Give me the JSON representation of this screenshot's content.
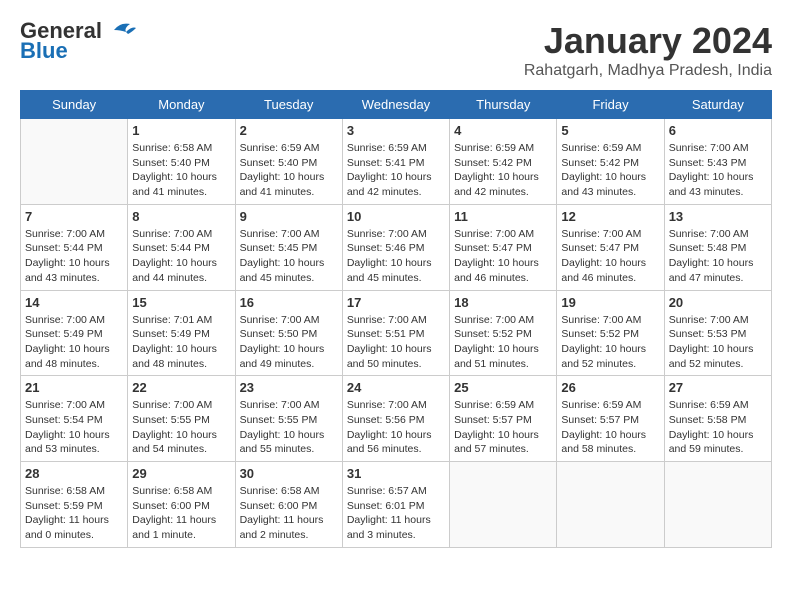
{
  "logo": {
    "line1": "General",
    "line2": "Blue"
  },
  "title": "January 2024",
  "subtitle": "Rahatgarh, Madhya Pradesh, India",
  "days_header": [
    "Sunday",
    "Monday",
    "Tuesday",
    "Wednesday",
    "Thursday",
    "Friday",
    "Saturday"
  ],
  "weeks": [
    [
      {
        "day": "",
        "sunrise": "",
        "sunset": "",
        "daylight": ""
      },
      {
        "day": "1",
        "sunrise": "Sunrise: 6:58 AM",
        "sunset": "Sunset: 5:40 PM",
        "daylight": "Daylight: 10 hours and 41 minutes."
      },
      {
        "day": "2",
        "sunrise": "Sunrise: 6:59 AM",
        "sunset": "Sunset: 5:40 PM",
        "daylight": "Daylight: 10 hours and 41 minutes."
      },
      {
        "day": "3",
        "sunrise": "Sunrise: 6:59 AM",
        "sunset": "Sunset: 5:41 PM",
        "daylight": "Daylight: 10 hours and 42 minutes."
      },
      {
        "day": "4",
        "sunrise": "Sunrise: 6:59 AM",
        "sunset": "Sunset: 5:42 PM",
        "daylight": "Daylight: 10 hours and 42 minutes."
      },
      {
        "day": "5",
        "sunrise": "Sunrise: 6:59 AM",
        "sunset": "Sunset: 5:42 PM",
        "daylight": "Daylight: 10 hours and 43 minutes."
      },
      {
        "day": "6",
        "sunrise": "Sunrise: 7:00 AM",
        "sunset": "Sunset: 5:43 PM",
        "daylight": "Daylight: 10 hours and 43 minutes."
      }
    ],
    [
      {
        "day": "7",
        "sunrise": "Sunrise: 7:00 AM",
        "sunset": "Sunset: 5:44 PM",
        "daylight": "Daylight: 10 hours and 43 minutes."
      },
      {
        "day": "8",
        "sunrise": "Sunrise: 7:00 AM",
        "sunset": "Sunset: 5:44 PM",
        "daylight": "Daylight: 10 hours and 44 minutes."
      },
      {
        "day": "9",
        "sunrise": "Sunrise: 7:00 AM",
        "sunset": "Sunset: 5:45 PM",
        "daylight": "Daylight: 10 hours and 45 minutes."
      },
      {
        "day": "10",
        "sunrise": "Sunrise: 7:00 AM",
        "sunset": "Sunset: 5:46 PM",
        "daylight": "Daylight: 10 hours and 45 minutes."
      },
      {
        "day": "11",
        "sunrise": "Sunrise: 7:00 AM",
        "sunset": "Sunset: 5:47 PM",
        "daylight": "Daylight: 10 hours and 46 minutes."
      },
      {
        "day": "12",
        "sunrise": "Sunrise: 7:00 AM",
        "sunset": "Sunset: 5:47 PM",
        "daylight": "Daylight: 10 hours and 46 minutes."
      },
      {
        "day": "13",
        "sunrise": "Sunrise: 7:00 AM",
        "sunset": "Sunset: 5:48 PM",
        "daylight": "Daylight: 10 hours and 47 minutes."
      }
    ],
    [
      {
        "day": "14",
        "sunrise": "Sunrise: 7:00 AM",
        "sunset": "Sunset: 5:49 PM",
        "daylight": "Daylight: 10 hours and 48 minutes."
      },
      {
        "day": "15",
        "sunrise": "Sunrise: 7:01 AM",
        "sunset": "Sunset: 5:49 PM",
        "daylight": "Daylight: 10 hours and 48 minutes."
      },
      {
        "day": "16",
        "sunrise": "Sunrise: 7:00 AM",
        "sunset": "Sunset: 5:50 PM",
        "daylight": "Daylight: 10 hours and 49 minutes."
      },
      {
        "day": "17",
        "sunrise": "Sunrise: 7:00 AM",
        "sunset": "Sunset: 5:51 PM",
        "daylight": "Daylight: 10 hours and 50 minutes."
      },
      {
        "day": "18",
        "sunrise": "Sunrise: 7:00 AM",
        "sunset": "Sunset: 5:52 PM",
        "daylight": "Daylight: 10 hours and 51 minutes."
      },
      {
        "day": "19",
        "sunrise": "Sunrise: 7:00 AM",
        "sunset": "Sunset: 5:52 PM",
        "daylight": "Daylight: 10 hours and 52 minutes."
      },
      {
        "day": "20",
        "sunrise": "Sunrise: 7:00 AM",
        "sunset": "Sunset: 5:53 PM",
        "daylight": "Daylight: 10 hours and 52 minutes."
      }
    ],
    [
      {
        "day": "21",
        "sunrise": "Sunrise: 7:00 AM",
        "sunset": "Sunset: 5:54 PM",
        "daylight": "Daylight: 10 hours and 53 minutes."
      },
      {
        "day": "22",
        "sunrise": "Sunrise: 7:00 AM",
        "sunset": "Sunset: 5:55 PM",
        "daylight": "Daylight: 10 hours and 54 minutes."
      },
      {
        "day": "23",
        "sunrise": "Sunrise: 7:00 AM",
        "sunset": "Sunset: 5:55 PM",
        "daylight": "Daylight: 10 hours and 55 minutes."
      },
      {
        "day": "24",
        "sunrise": "Sunrise: 7:00 AM",
        "sunset": "Sunset: 5:56 PM",
        "daylight": "Daylight: 10 hours and 56 minutes."
      },
      {
        "day": "25",
        "sunrise": "Sunrise: 6:59 AM",
        "sunset": "Sunset: 5:57 PM",
        "daylight": "Daylight: 10 hours and 57 minutes."
      },
      {
        "day": "26",
        "sunrise": "Sunrise: 6:59 AM",
        "sunset": "Sunset: 5:57 PM",
        "daylight": "Daylight: 10 hours and 58 minutes."
      },
      {
        "day": "27",
        "sunrise": "Sunrise: 6:59 AM",
        "sunset": "Sunset: 5:58 PM",
        "daylight": "Daylight: 10 hours and 59 minutes."
      }
    ],
    [
      {
        "day": "28",
        "sunrise": "Sunrise: 6:58 AM",
        "sunset": "Sunset: 5:59 PM",
        "daylight": "Daylight: 11 hours and 0 minutes."
      },
      {
        "day": "29",
        "sunrise": "Sunrise: 6:58 AM",
        "sunset": "Sunset: 6:00 PM",
        "daylight": "Daylight: 11 hours and 1 minute."
      },
      {
        "day": "30",
        "sunrise": "Sunrise: 6:58 AM",
        "sunset": "Sunset: 6:00 PM",
        "daylight": "Daylight: 11 hours and 2 minutes."
      },
      {
        "day": "31",
        "sunrise": "Sunrise: 6:57 AM",
        "sunset": "Sunset: 6:01 PM",
        "daylight": "Daylight: 11 hours and 3 minutes."
      },
      {
        "day": "",
        "sunrise": "",
        "sunset": "",
        "daylight": ""
      },
      {
        "day": "",
        "sunrise": "",
        "sunset": "",
        "daylight": ""
      },
      {
        "day": "",
        "sunrise": "",
        "sunset": "",
        "daylight": ""
      }
    ]
  ]
}
